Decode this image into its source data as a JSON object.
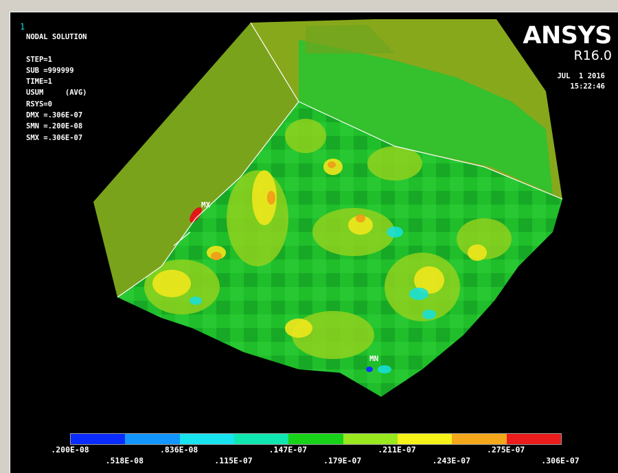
{
  "window_number": "1",
  "info_lines": [
    "NODAL SOLUTION",
    "",
    "STEP=1",
    "SUB =999999",
    "TIME=1",
    "USUM     (AVG)",
    "RSYS=0",
    "DMX =.306E-07",
    "SMN =.200E-08",
    "SMX =.306E-07"
  ],
  "logo": {
    "brand": "ANSYS",
    "version": "R16.0"
  },
  "date": "JUL  1 2016",
  "time": "15:22:46",
  "markers": {
    "max": "MX",
    "min": "MN"
  },
  "legend": {
    "colors": [
      "#0a2cff",
      "#1496ff",
      "#18e4f0",
      "#10e6b0",
      "#18d21a",
      "#9ae81e",
      "#f5f21a",
      "#f5a71c",
      "#ea1c1c"
    ],
    "top_labels": [
      ".200E-08",
      ".836E-08",
      ".147E-07",
      ".211E-07",
      ".275E-07"
    ],
    "bottom_labels": [
      ".518E-08",
      ".115E-07",
      ".179E-07",
      ".243E-07",
      ".306E-07"
    ]
  }
}
